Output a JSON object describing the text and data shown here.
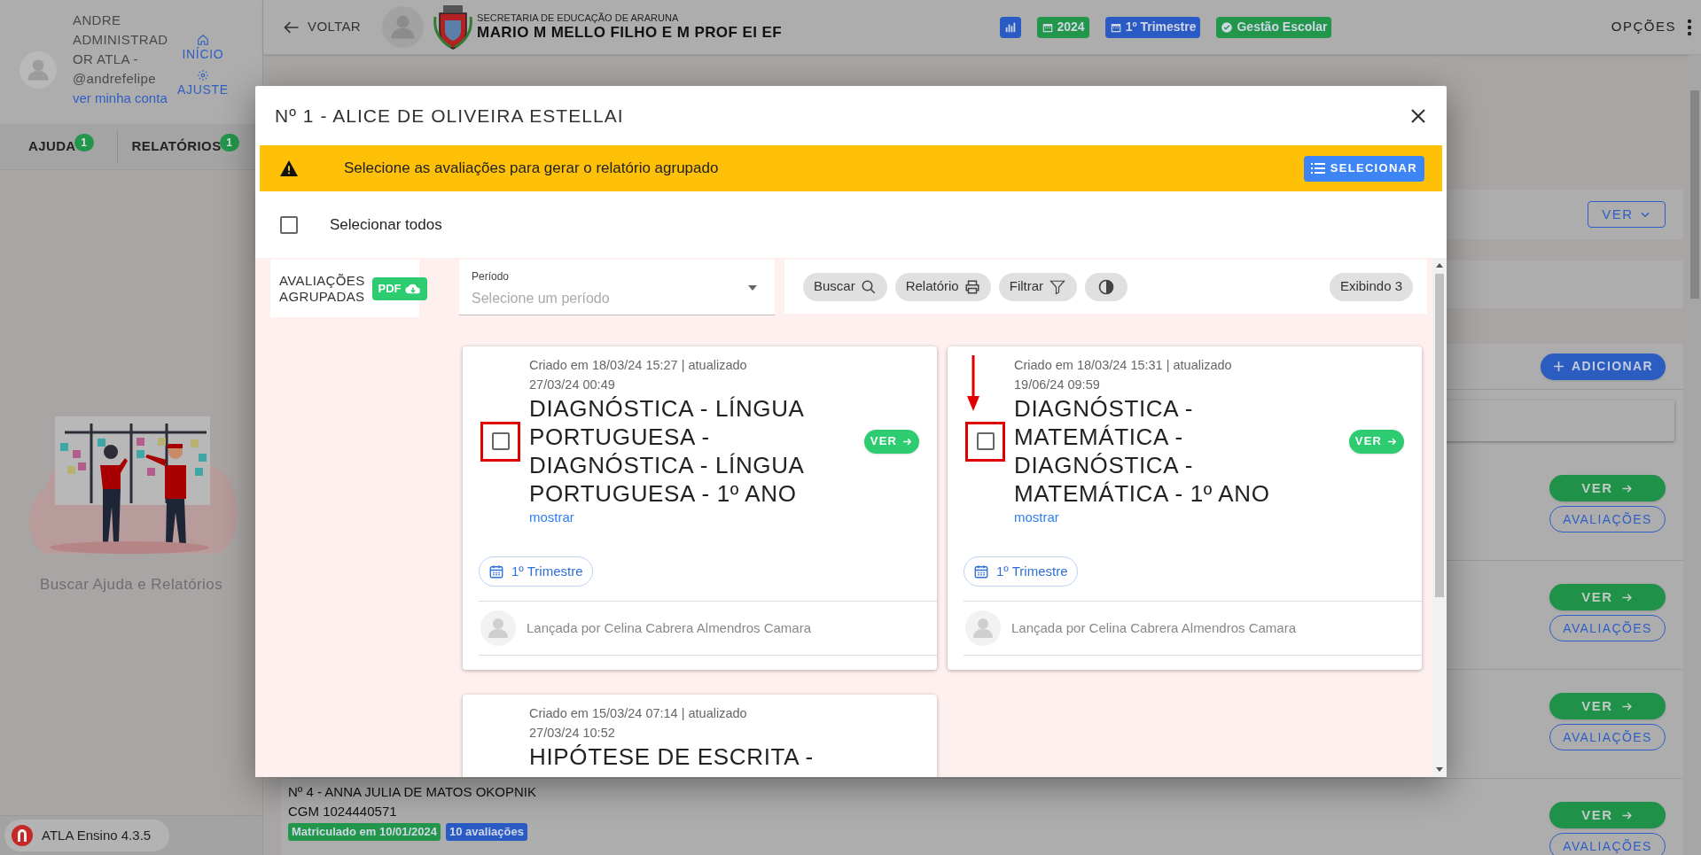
{
  "sidebar": {
    "user": {
      "name": "ANDRE ADMINISTRADOR ATLA - @andrefelipe",
      "link": "ver minha conta"
    },
    "shortcuts": [
      {
        "kind": "home",
        "label": "INÍCIO"
      },
      {
        "kind": "settings",
        "label": "AJUSTE"
      }
    ],
    "tabs": [
      {
        "label": "AJUDA",
        "badge": "1"
      },
      {
        "label": "RELATÓRIOS",
        "badge": "1"
      }
    ],
    "empty_message": "Buscar Ajuda e Relatórios",
    "version": "ATLA Ensino 4.3.5"
  },
  "header": {
    "back": "VOLTAR",
    "org": "SECRETARIA DE EDUCAÇÃO DE ARARUNA",
    "school": "MARIO M MELLO FILHO E M PROF EI EF",
    "badges": [
      {
        "kind": "chart",
        "color": "#2a5bc4"
      },
      {
        "kind": "calendar",
        "label": "2024",
        "color": "#22964a"
      },
      {
        "kind": "calendar",
        "label": "1º Trimestre",
        "color": "#2a5bc4"
      },
      {
        "kind": "check",
        "label": "Gestão Escolar",
        "color": "#22964a"
      }
    ],
    "options": "OPÇÕES"
  },
  "page": {
    "panel_button": "VER",
    "add_button": "ADICIONAR",
    "students": [
      {
        "view": "VER",
        "evaluations": "AVALIAÇÕES"
      },
      {
        "view": "VER",
        "evaluations": "AVALIAÇÕES"
      },
      {
        "view": "VER",
        "evaluations": "AVALIAÇÕES"
      },
      {
        "name": "Nº 4 - ANNA JULIA DE MATOS OKOPNIK",
        "cgm": "CGM 1024440571",
        "tags": [
          {
            "label": "Matriculado em 10/01/2024",
            "color": "#22964a"
          },
          {
            "label": "10 avaliações",
            "color": "#2a5bc4"
          }
        ],
        "view": "VER",
        "evaluations": "AVALIAÇÕES"
      }
    ]
  },
  "modal": {
    "title": "Nº 1 - ALICE DE OLIVEIRA ESTELLAI",
    "alert": {
      "message": "Selecione as avaliações para gerar o relatório agrupado",
      "button": "SELECIONAR"
    },
    "select_all": {
      "label": "Selecionar todos",
      "checked": false
    },
    "grouped": {
      "label": "AVALIAÇÕES AGRUPADAS",
      "button": "PDF"
    },
    "period": {
      "label": "Período",
      "placeholder": "Selecione um período"
    },
    "toolbar": [
      {
        "kind": "search",
        "label": "Buscar"
      },
      {
        "kind": "print",
        "label": "Relatório"
      },
      {
        "kind": "filter",
        "label": "Filtrar"
      },
      {
        "kind": "contrast"
      }
    ],
    "count": "Exibindo 3",
    "cards": [
      {
        "meta": "Criado em 18/03/24 15:27 | atualizado 27/03/24 00:49",
        "title": "DIAGNÓSTICA - LÍNGUA PORTUGUESA - DIAGNÓSTICA - LÍNGUA PORTUGUESA - 1º ANO",
        "more": "mostrar",
        "view": "VER",
        "period": "1º Trimestre",
        "author": "Lançada por Celina Cabrera Almendros Camara",
        "checked": false,
        "highlighted": true,
        "arrow": false
      },
      {
        "meta": "Criado em 18/03/24 15:31 | atualizado 19/06/24 09:59",
        "title": "DIAGNÓSTICA - MATEMÁTICA - DIAGNÓSTICA - MATEMÁTICA - 1º ANO",
        "more": "mostrar",
        "view": "VER",
        "period": "1º Trimestre",
        "author": "Lançada por Celina Cabrera Almendros Camara",
        "checked": false,
        "highlighted": true,
        "arrow": true
      },
      {
        "meta": "Criado em 15/03/24 07:14 | atualizado 27/03/24 10:52",
        "title": "HIPÓTESE DE ESCRITA -"
      }
    ]
  }
}
